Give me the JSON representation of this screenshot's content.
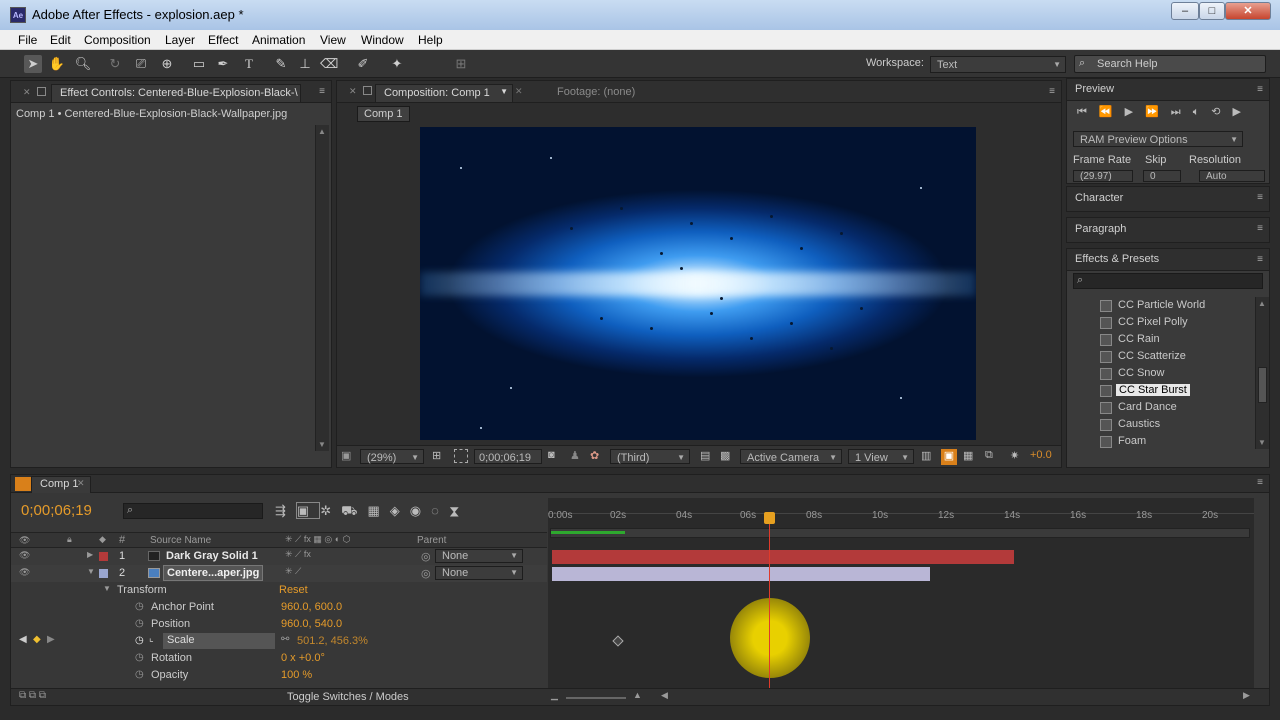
{
  "window": {
    "title": "Adobe After Effects - explosion.aep *",
    "app_icon": "Ae",
    "min": "–",
    "max": "□",
    "close": "✕"
  },
  "menu": [
    "File",
    "Edit",
    "Composition",
    "Layer",
    "Effect",
    "Animation",
    "View",
    "Window",
    "Help"
  ],
  "toolbar": {
    "workspace_label": "Workspace:",
    "workspace_value": "Text",
    "search_placeholder": "Search Help"
  },
  "effect_controls": {
    "tab": "Effect Controls: Centered-Blue-Explosion-Black-\\",
    "subtitle": "Comp 1 • Centered-Blue-Explosion-Black-Wallpaper.jpg"
  },
  "composition": {
    "tab": "Composition: Comp 1",
    "footage_tab": "Footage: (none)",
    "breadcrumb": "Comp 1",
    "zoom": "(29%)",
    "timecode": "0;00;06;19",
    "resolution": "(Third)",
    "camera": "Active Camera",
    "views": "1 View",
    "exposure": "+0.0"
  },
  "preview": {
    "title": "Preview",
    "ram_options": "RAM Preview Options",
    "frame_rate_label": "Frame Rate",
    "skip_label": "Skip",
    "resolution_label": "Resolution",
    "frame_rate": "(29.97)",
    "skip": "0",
    "resolution": "Auto"
  },
  "character": {
    "title": "Character"
  },
  "paragraph": {
    "title": "Paragraph"
  },
  "effects_presets": {
    "title": "Effects & Presets",
    "search_placeholder": "",
    "items": [
      "CC Particle World",
      "CC Pixel Polly",
      "CC Rain",
      "CC Scatterize",
      "CC Snow",
      "CC Star Burst",
      "Card Dance",
      "Caustics",
      "Foam"
    ],
    "selected": "CC Star Burst"
  },
  "timeline": {
    "tab": "Comp 1",
    "timecode": "0;00;06;19",
    "col_num": "#",
    "col_source": "Source Name",
    "col_parent": "Parent",
    "layers": [
      {
        "num": "1",
        "name": "Dark Gray Solid 1",
        "parent": "None",
        "color": "#b33a3a"
      },
      {
        "num": "2",
        "name": "Centere...aper.jpg",
        "parent": "None",
        "color": "#9aa6cf"
      }
    ],
    "transform_label": "Transform",
    "reset_label": "Reset",
    "properties": [
      {
        "name": "Anchor Point",
        "value": "960.0, 600.0"
      },
      {
        "name": "Position",
        "value": "960.0, 540.0"
      },
      {
        "name": "Scale",
        "value": "501.2, 456.3%"
      },
      {
        "name": "Rotation",
        "value": "0 x +0.0°"
      },
      {
        "name": "Opacity",
        "value": "100 %"
      }
    ],
    "ticks": [
      "0:00s",
      "02s",
      "04s",
      "06s",
      "08s",
      "10s",
      "12s",
      "14s",
      "16s",
      "18s",
      "20s"
    ],
    "toggle_label": "Toggle Switches / Modes"
  }
}
